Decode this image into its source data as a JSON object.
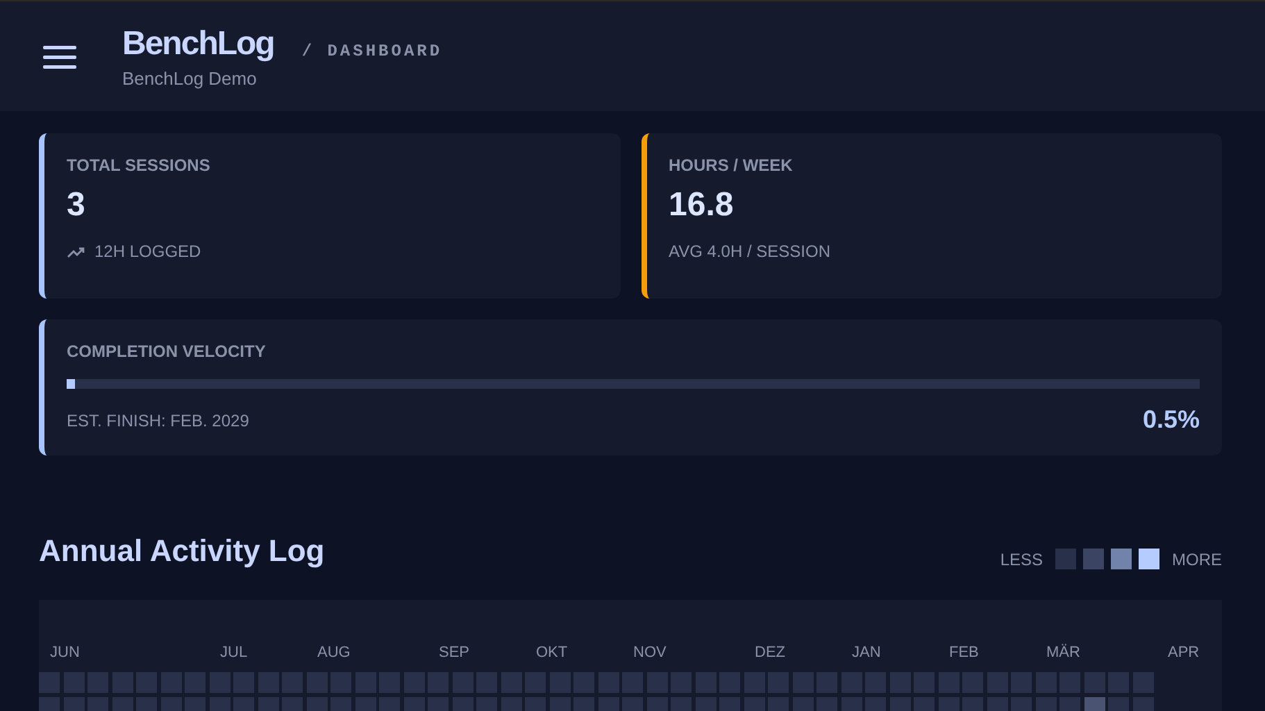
{
  "header": {
    "title": "BenchLog",
    "subtitle": "BenchLog Demo",
    "breadcrumb": "/ DASHBOARD"
  },
  "stats": [
    {
      "label": "TOTAL SESSIONS",
      "value": "3",
      "note": "12H LOGGED",
      "trend_icon": true,
      "color": "#a8c4ff"
    },
    {
      "label": "HOURS / WEEK",
      "value": "16.8",
      "note": "AVG 4.0H / SESSION",
      "trend_icon": false,
      "color": "#f59e0b"
    }
  ],
  "velocity": {
    "label": "COMPLETION VELOCITY",
    "level": 0.005,
    "finish": "EST. FINISH: FEB. 2029",
    "percent": "0.5%"
  },
  "activity": {
    "title": "Annual Activity Log",
    "legend_less": "LESS",
    "legend_more": "MORE",
    "legend": [
      {
        "color": "#283149"
      },
      {
        "color": "#3b4563"
      },
      {
        "color": "#7183ab"
      },
      {
        "color": "#b4ccff"
      }
    ],
    "months": [
      {
        "label": "JUN",
        "weeks": [
          [
            {
              "color": "#283149"
            },
            {
              "color": "#283149"
            }
          ],
          [
            {
              "color": "#283149"
            },
            {
              "color": "#283149"
            }
          ],
          [
            {
              "color": "#283149"
            },
            {
              "color": "#283149"
            }
          ],
          [
            {
              "color": "#283149"
            },
            {
              "color": "#283149"
            }
          ],
          [
            {
              "color": "#283149"
            },
            {
              "color": "#283149"
            }
          ],
          [
            {
              "color": "#283149"
            },
            {
              "color": "#283149"
            }
          ],
          [
            {
              "color": "#283149"
            },
            {
              "color": "#283149"
            }
          ]
        ]
      },
      {
        "label": "JUL",
        "weeks": [
          [
            {
              "color": "#283149"
            },
            {
              "color": "#283149"
            }
          ],
          [
            {
              "color": "#283149"
            },
            {
              "color": "#283149"
            }
          ],
          [
            {
              "color": "#283149"
            },
            {
              "color": "#283149"
            }
          ],
          [
            {
              "color": "#283149"
            },
            {
              "color": "#283149"
            }
          ]
        ]
      },
      {
        "label": "AUG",
        "weeks": [
          [
            {
              "color": "#283149"
            },
            {
              "color": "#283149"
            }
          ],
          [
            {
              "color": "#283149"
            },
            {
              "color": "#283149"
            }
          ],
          [
            {
              "color": "#283149"
            },
            {
              "color": "#283149"
            }
          ],
          [
            {
              "color": "#283149"
            },
            {
              "color": "#283149"
            }
          ],
          [
            {
              "color": "#283149"
            },
            {
              "color": "#283149"
            }
          ]
        ]
      },
      {
        "label": "SEP",
        "weeks": [
          [
            {
              "color": "#283149"
            },
            {
              "color": "#283149"
            }
          ],
          [
            {
              "color": "#283149"
            },
            {
              "color": "#283149"
            }
          ],
          [
            {
              "color": "#283149"
            },
            {
              "color": "#283149"
            }
          ],
          [
            {
              "color": "#283149"
            },
            {
              "color": "#283149"
            }
          ]
        ]
      },
      {
        "label": "OKT",
        "weeks": [
          [
            {
              "color": "#283149"
            },
            {
              "color": "#283149"
            }
          ],
          [
            {
              "color": "#283149"
            },
            {
              "color": "#283149"
            }
          ],
          [
            {
              "color": "#283149"
            },
            {
              "color": "#283149"
            }
          ],
          [
            {
              "color": "#283149"
            },
            {
              "color": "#283149"
            }
          ]
        ]
      },
      {
        "label": "NOV",
        "weeks": [
          [
            {
              "color": "#283149"
            },
            {
              "color": "#283149"
            }
          ],
          [
            {
              "color": "#283149"
            },
            {
              "color": "#283149"
            }
          ],
          [
            {
              "color": "#283149"
            },
            {
              "color": "#283149"
            }
          ],
          [
            {
              "color": "#283149"
            },
            {
              "color": "#283149"
            }
          ],
          [
            {
              "color": "#283149"
            },
            {
              "color": "#283149"
            }
          ]
        ]
      },
      {
        "label": "DEZ",
        "weeks": [
          [
            {
              "color": "#283149"
            },
            {
              "color": "#283149"
            }
          ],
          [
            {
              "color": "#283149"
            },
            {
              "color": "#283149"
            }
          ],
          [
            {
              "color": "#283149"
            },
            {
              "color": "#283149"
            }
          ],
          [
            {
              "color": "#283149"
            },
            {
              "color": "#283149"
            }
          ]
        ]
      },
      {
        "label": "JAN",
        "weeks": [
          [
            {
              "color": "#283149"
            },
            {
              "color": "#283149"
            }
          ],
          [
            {
              "color": "#283149"
            },
            {
              "color": "#283149"
            }
          ],
          [
            {
              "color": "#283149"
            },
            {
              "color": "#283149"
            }
          ],
          [
            {
              "color": "#283149"
            },
            {
              "color": "#283149"
            }
          ]
        ]
      },
      {
        "label": "FEB",
        "weeks": [
          [
            {
              "color": "#283149"
            },
            {
              "color": "#283149"
            }
          ],
          [
            {
              "color": "#283149"
            },
            {
              "color": "#283149"
            }
          ],
          [
            {
              "color": "#283149"
            },
            {
              "color": "#283149"
            }
          ],
          [
            {
              "color": "#283149"
            },
            {
              "color": "#283149"
            }
          ]
        ]
      },
      {
        "label": "MÄR",
        "weeks": [
          [
            {
              "color": "#283149"
            },
            {
              "color": "#283149"
            }
          ],
          [
            {
              "color": "#283149"
            },
            {
              "color": "#283149"
            }
          ],
          [
            {
              "color": "#283149"
            },
            {
              "color": "#4a5472"
            }
          ],
          [
            {
              "color": "#283149"
            },
            {
              "color": "#283149"
            }
          ],
          [
            {
              "color": "#283149"
            },
            {
              "color": "#283149"
            }
          ]
        ]
      },
      {
        "label": "APR"
      }
    ]
  }
}
